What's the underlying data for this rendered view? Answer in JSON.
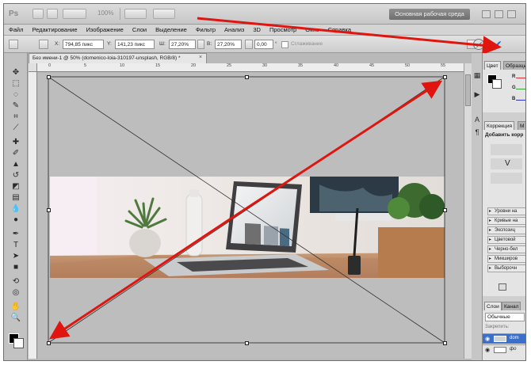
{
  "appbar": {
    "logo": "Ps",
    "zoom": "100%",
    "workspace_button": "Основная рабочая среда"
  },
  "menu": {
    "items": [
      "Файл",
      "Редактирование",
      "Изображение",
      "Слои",
      "Выделение",
      "Фильтр",
      "Анализ",
      "3D",
      "Просмотр",
      "Окно",
      "Справка"
    ]
  },
  "options": {
    "x_label": "X:",
    "x_value": "794,85 пикс",
    "y_label": "Y:",
    "y_value": "141,23 пикс",
    "w_label": "Ш:",
    "w_value": "27,20%",
    "h_label": "В:",
    "h_value": "27,20%",
    "angle_value": "0,00",
    "angle_unit": "°",
    "smoothing": "Сглаживание",
    "commit_glyph": "✔"
  },
  "document": {
    "tab_title": "Без имени-1 @ 50% (domenico-loia-310197-unsplash, RGB/8) *",
    "close_glyph": "×",
    "ruler_ticks": [
      "0",
      "5",
      "10",
      "15",
      "20",
      "25",
      "30",
      "35",
      "40",
      "45",
      "50",
      "55"
    ]
  },
  "panels": {
    "color_tab": "Цвет",
    "swatches_tab": "Образцы",
    "channels": [
      "R",
      "G",
      "B"
    ],
    "correction_tab": "Коррекция",
    "masks_tab": "М",
    "add_correction": "Добавить корр",
    "adjustment_presets": [
      "Уровни на",
      "Кривые на",
      "Экспозиц",
      "Цветовой",
      "Черно-бел",
      "Микширов",
      "Выборочн"
    ],
    "layers_tab": "Слои",
    "channels_tab": "Канал",
    "blend_mode": "Обычные",
    "lock_label": "Закрепить:",
    "layer_names": [
      "dom",
      "фо"
    ]
  },
  "colors": {
    "arrow_red": "#e0150f",
    "accent_blue": "#1e6ec9",
    "canvas_gray": "#bdbdbd"
  }
}
